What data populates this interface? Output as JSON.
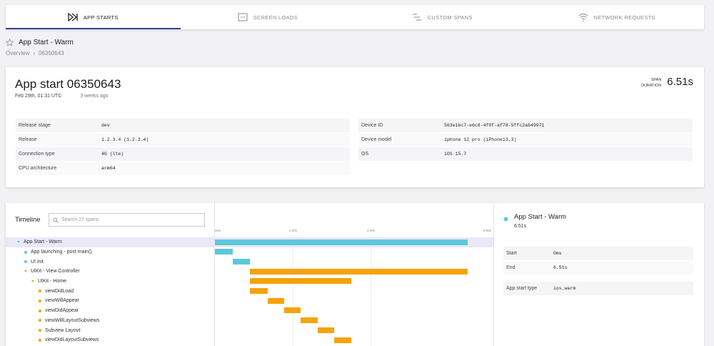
{
  "tabs": [
    {
      "label": "APP STARTS",
      "icon": "app-start-icon",
      "active": true
    },
    {
      "label": "SCREEN LOADS",
      "icon": "screen-icon",
      "active": false
    },
    {
      "label": "CUSTOM SPANS",
      "icon": "spans-icon",
      "active": false
    },
    {
      "label": "NETWORK REQUESTS",
      "icon": "wifi-icon",
      "active": false
    }
  ],
  "page": {
    "title": "App Start - Warm",
    "breadcrumb": [
      "Overview",
      "›",
      "06350643"
    ]
  },
  "summary": {
    "title": "App start 06350643",
    "date": "Feb 29th, 01:31 UTC",
    "ago": "3 weeks ago",
    "span_label_1": "SPAN",
    "span_label_2": "DURATION",
    "duration": "6.51s"
  },
  "attributes_left": [
    {
      "key": "Release stage",
      "value": "dev"
    },
    {
      "key": "Release",
      "value": "1.2.3.4 (1.2.3.4)"
    },
    {
      "key": "Connection type",
      "value": "4G (lte)"
    },
    {
      "key": "CPU architecture",
      "value": "arm64"
    }
  ],
  "attributes_right": [
    {
      "key": "Device ID",
      "value": "563e1bc7-e6c8-4f0f-af78-5ffc2a649971"
    },
    {
      "key": "Device model",
      "value": "iphone 12 pro (iPhone13,3)"
    },
    {
      "key": "OS",
      "value": "iOS 15.7"
    }
  ],
  "timeline": {
    "title": "Timeline",
    "search_placeholder": "Search 27 spans",
    "ticks": [
      "0ms",
      "2.00s",
      "4.00s",
      "6.95s"
    ],
    "axis_max_s": 6.95,
    "spans": [
      {
        "label": "App Start - Warm",
        "depth": 0,
        "marker": "caret",
        "color": "#5bc8db",
        "start": 0,
        "end": 6.51,
        "selected": true
      },
      {
        "label": "App launching - post main()",
        "depth": 1,
        "marker": "dot",
        "color": "#5bc8db",
        "start": 0,
        "end": 0.45
      },
      {
        "label": "UI init",
        "depth": 1,
        "marker": "dot",
        "color": "#5bc8db",
        "start": 0.45,
        "end": 0.9
      },
      {
        "label": "UIKit - View Controller",
        "depth": 1,
        "marker": "caret",
        "color": "#f5a30a",
        "start": 0.9,
        "end": 6.51
      },
      {
        "label": "UIKit - Home",
        "depth": 2,
        "marker": "caret",
        "color": "#f5a30a",
        "start": 0.9,
        "end": 3.5
      },
      {
        "label": "viewDidLoad",
        "depth": 3,
        "marker": "dot",
        "color": "#f5a30a",
        "start": 0.9,
        "end": 1.35
      },
      {
        "label": "viewWillAppear",
        "depth": 3,
        "marker": "dot",
        "color": "#f5a30a",
        "start": 1.35,
        "end": 1.78
      },
      {
        "label": "viewDidAppear",
        "depth": 3,
        "marker": "dot",
        "color": "#f5a30a",
        "start": 1.78,
        "end": 2.21
      },
      {
        "label": "viewWillLayoutSubviews",
        "depth": 3,
        "marker": "dot",
        "color": "#f5a30a",
        "start": 2.21,
        "end": 2.64
      },
      {
        "label": "Subview Layout",
        "depth": 3,
        "marker": "dot",
        "color": "#f5a30a",
        "start": 2.64,
        "end": 3.07
      },
      {
        "label": "viewDidLayoutSubviews",
        "depth": 3,
        "marker": "dot",
        "color": "#f5a30a",
        "start": 3.07,
        "end": 3.5
      }
    ]
  },
  "detail": {
    "title": "App Start - Warm",
    "duration": "6.51s",
    "color": "#5bc8db",
    "rows": [
      {
        "key": "Start",
        "value": "0ms"
      },
      {
        "key": "End",
        "value": "6.51s"
      }
    ],
    "type_rows": [
      {
        "key": "App start type",
        "value": "ios_warm"
      }
    ]
  }
}
